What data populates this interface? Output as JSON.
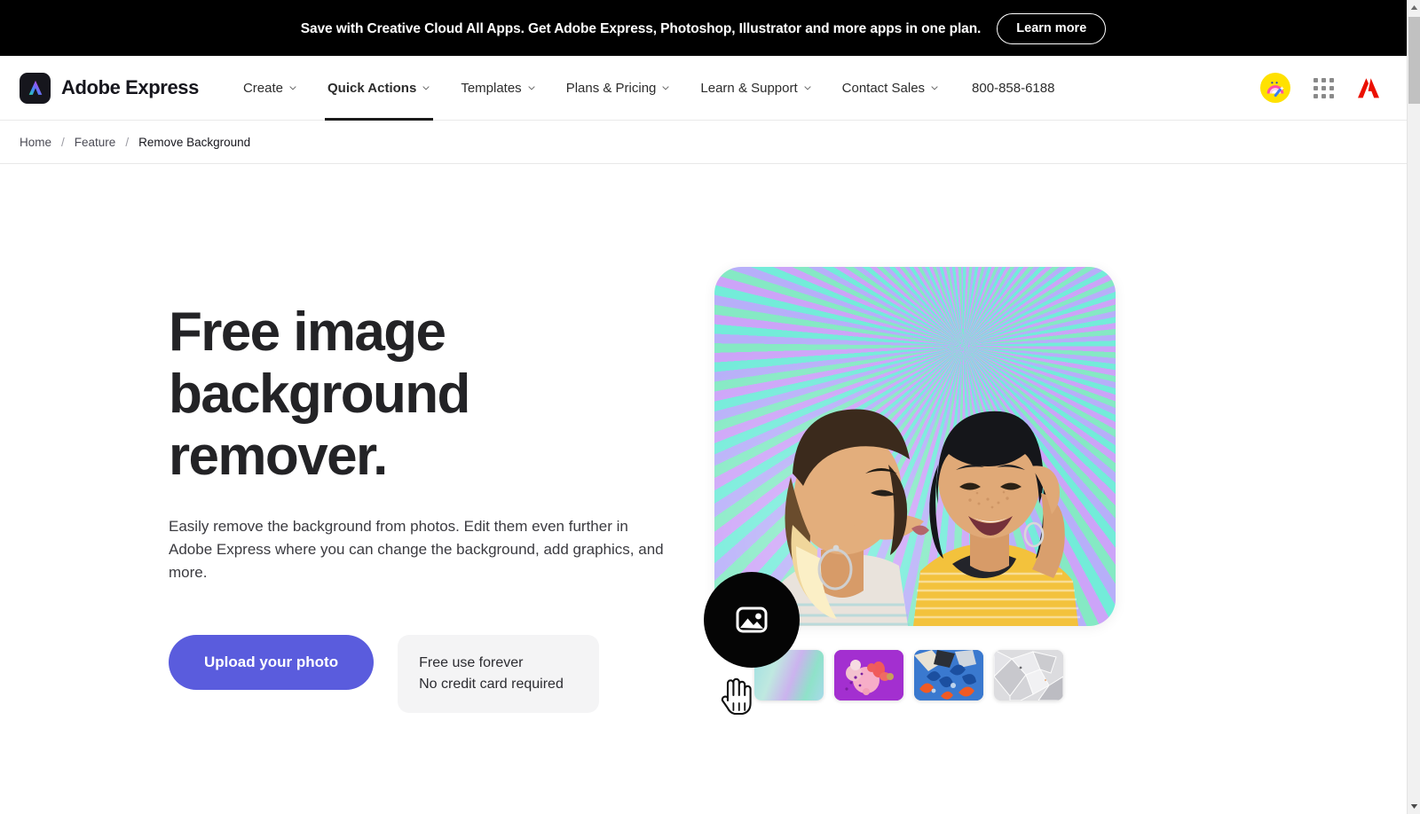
{
  "promo": {
    "text": "Save with Creative Cloud All Apps. Get Adobe Express, Photoshop, Illustrator and more apps in one plan.",
    "button_label": "Learn more"
  },
  "nav": {
    "brand_name": "Adobe Express",
    "brand_icon": "adobe-express-logo-icon",
    "links": [
      {
        "label": "Create",
        "has_caret": true,
        "active": false
      },
      {
        "label": "Quick Actions",
        "has_caret": true,
        "active": true
      },
      {
        "label": "Templates",
        "has_caret": true,
        "active": false
      },
      {
        "label": "Plans & Pricing",
        "has_caret": true,
        "active": false
      },
      {
        "label": "Learn & Support",
        "has_caret": true,
        "active": false
      },
      {
        "label": "Contact Sales",
        "has_caret": true,
        "active": false
      }
    ],
    "phone": "800-858-6188",
    "right_icons": [
      {
        "name": "magic-wand-badge-icon",
        "color": "#ffe100"
      },
      {
        "name": "app-grid-icon",
        "color": "#8a8a8a"
      },
      {
        "name": "adobe-logo-icon",
        "color": "#eb1000"
      }
    ]
  },
  "breadcrumb": {
    "items": [
      {
        "label": "Home",
        "current": false
      },
      {
        "label": "Feature",
        "current": false
      },
      {
        "label": "Remove Background",
        "current": true
      }
    ],
    "separator": "/"
  },
  "hero": {
    "title": "Free image background remover.",
    "subtitle": "Easily remove the background from photos. Edit them even further in Adobe Express where you can change the background, add graphics, and more.",
    "cta_label": "Upload your photo",
    "cta_color": "#5a5cdd",
    "note_line1": "Free use forever",
    "note_line2": "No credit card required",
    "badge_icon": "image-placeholder-icon",
    "photo_alt": "Two women embracing in front of an iridescent holographic backdrop",
    "thumbnails": [
      {
        "name": "thumbnail-holographic",
        "selected": true
      },
      {
        "name": "thumbnail-purple-abstract",
        "selected": false
      },
      {
        "name": "thumbnail-blue-floral",
        "selected": false
      },
      {
        "name": "thumbnail-silver-crystal",
        "selected": false
      }
    ],
    "cursor": "hand-pointer-cursor"
  },
  "browser": {
    "scrollbar_up_icon": "scroll-up-arrow-icon",
    "scrollbar_down_icon": "scroll-down-arrow-icon"
  }
}
